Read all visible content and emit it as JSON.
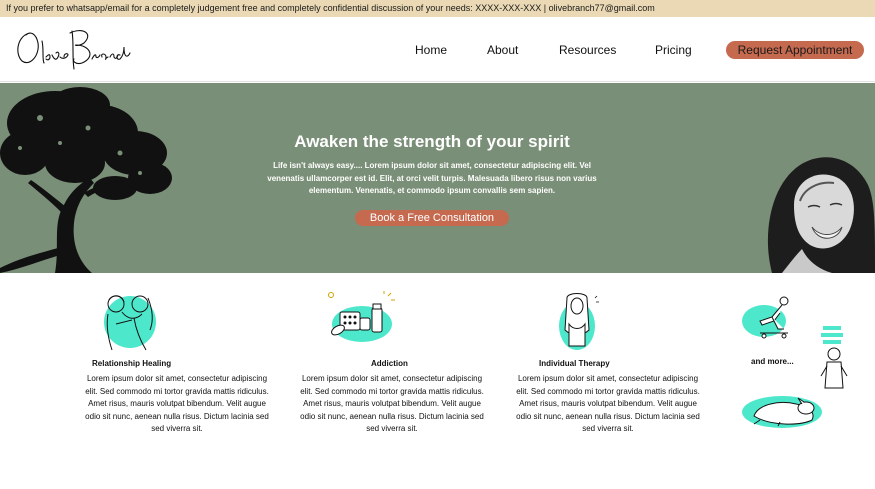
{
  "topbar": {
    "text": "If you prefer to whatsapp/email for a completely judgement free and completely confidential discussion of your needs: XXXX-XXX-XXX  |  olivebranch77@gmail.com"
  },
  "header": {
    "logo_text": "Olive Branch",
    "nav": [
      "Home",
      "About",
      "Resources",
      "Pricing"
    ],
    "cta": "Request Appointment"
  },
  "hero": {
    "title": "Awaken the strength of your spirit",
    "body": "Life isn't always easy.... Lorem ipsum dolor sit amet, consectetur adipiscing elit. Vel venenatis ullamcorper est id. Elit, at orci velit turpis. Malesuada libero risus non varius elementum. Venenatis, et commodo ipsum convallis sem sapien.",
    "button": "Book a Free Consultation",
    "colors": {
      "background": "#7a8f77",
      "button": "#c5694f"
    }
  },
  "services": [
    {
      "title": "Relationship Healing",
      "icon": "couple-icon",
      "text": "Lorem ipsum dolor sit amet, consectetur adipiscing elit. Sed commodo mi tortor gravida mattis ridiculus. Amet risus, mauris volutpat bibendum. Velit augue odio sit nunc, aenean nulla risus. Dictum lacinia sed sed viverra sit."
    },
    {
      "title": "Addiction",
      "icon": "pills-icon",
      "text": "Lorem ipsum dolor sit amet, consectetur adipiscing elit. Sed commodo mi tortor gravida mattis ridiculus. Amet risus, mauris volutpat bibendum. Velit augue odio sit nunc, aenean nulla risus. Dictum lacinia sed sed viverra sit."
    },
    {
      "title": "Individual Therapy",
      "icon": "person-icon",
      "text": "Lorem ipsum dolor sit amet, consectetur adipiscing elit. Sed commodo mi tortor gravida mattis ridiculus. Amet risus, mauris volutpat bibendum. Velit augue odio sit nunc, aenean nulla risus. Dictum lacinia sed sed viverra sit."
    }
  ],
  "more": {
    "label": "and more..."
  },
  "accent_color": "#4de8cc"
}
